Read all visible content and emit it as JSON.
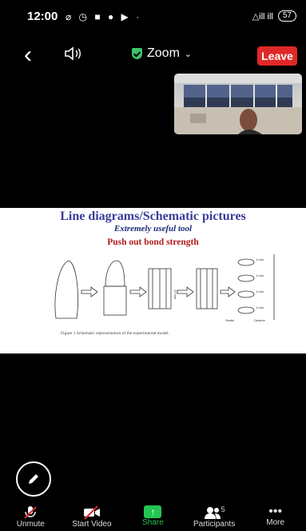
{
  "status": {
    "time": "12:00",
    "battery": "57",
    "signal": "△ill ill"
  },
  "nav": {
    "meeting_title": "Zoom",
    "leave_label": "Leave"
  },
  "slide": {
    "title": "Line diagrams/Schematic pictures",
    "subtitle": "Extremely useful tool",
    "heading": "Push out bond strength",
    "caption": "Figure 1  Schematic representation of the experimental model.",
    "labels": {
      "mm1": "1 mm",
      "mm2": "1 mm",
      "mm3": "1 mm",
      "mm4": "1 mm",
      "dim": "12 mm",
      "sealer": "Sealer",
      "dentine": "Dentine"
    }
  },
  "toolbar": {
    "unmute": "Unmute",
    "start_video": "Start Video",
    "share": "Share",
    "participants": "Participants",
    "participants_count": "5",
    "more": "More"
  }
}
